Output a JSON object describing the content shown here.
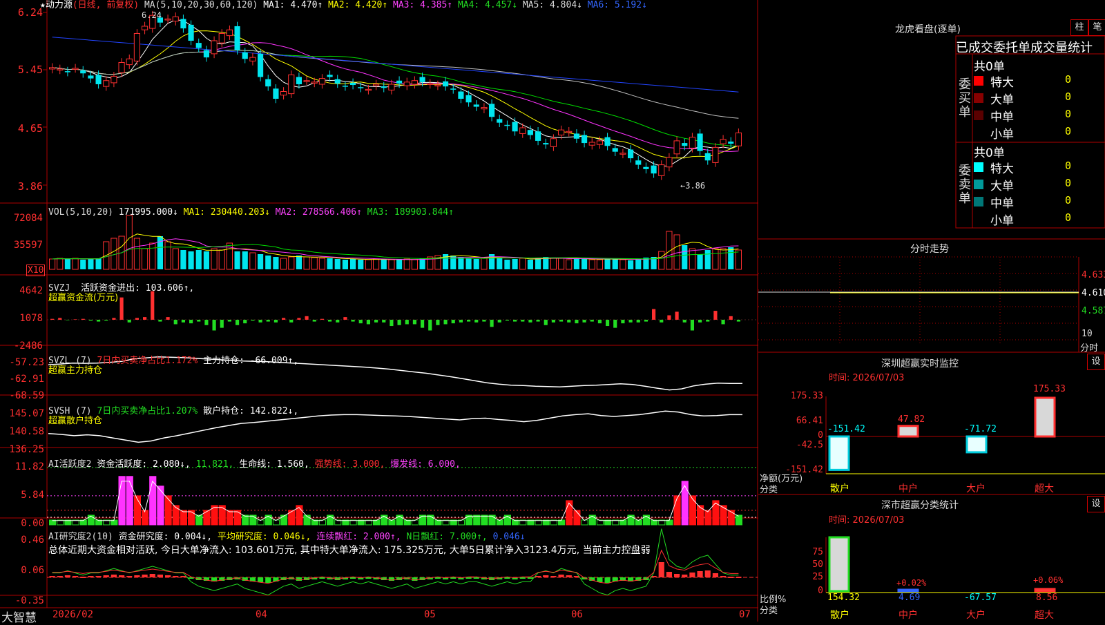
{
  "colors": {
    "up": "#ff3030",
    "down": "#00e5ee",
    "grid": "#b00000",
    "ma1": "#ffffff",
    "ma2": "#ffff00",
    "ma3": "#ff33ff",
    "ma4": "#00dd00",
    "ma5": "#c0c0c0",
    "ma6": "#2244ff",
    "text_yellow": "#ffff00",
    "text_magenta": "#ff44ff",
    "text_green": "#22dd22",
    "text_red": "#ff3030",
    "text_blue": "#3366ff"
  },
  "main": {
    "star": "★",
    "name": "动力源",
    "period": "(日线, 前复权)",
    "ma_params": "MA(5,10,20,30,60,120)",
    "ma_values": [
      {
        "label": "MA1: 4.470↑",
        "color": "ma1"
      },
      {
        "label": "MA2: 4.420↑",
        "color": "ma2"
      },
      {
        "label": "MA3: 4.385↑",
        "color": "ma3"
      },
      {
        "label": "MA4: 4.457↓",
        "color": "ma4"
      },
      {
        "label": "MA5: 4.804↓",
        "color": "ma5"
      },
      {
        "label": "MA6: 5.192↓",
        "color": "ma6"
      }
    ],
    "high_mark": "6.24",
    "low_mark": "←3.86",
    "y_ticks": [
      "6.24",
      "5.45",
      "4.65",
      "3.86"
    ]
  },
  "vol": {
    "title": "VOL(5,10,20)",
    "value": "171995.000↓",
    "ma1": "MA1: 230440.203↓",
    "ma2": "MA2: 278566.406↑",
    "ma3": "MA3: 189903.844↑",
    "y_ticks": [
      "72084",
      "35597"
    ],
    "unit": "X10"
  },
  "svzj": {
    "title": "SVZJ",
    "label": "活跃资金进出: 103.606↑,",
    "sub": "超赢资金流(万元)",
    "y_ticks": [
      "4642",
      "1078",
      "-2486"
    ]
  },
  "svzl": {
    "title": "SVZL (7)",
    "label1": "7日内买卖净占比1.172%",
    "label2": "主力持仓: -66.009↑,",
    "sub": "超赢主力持仓",
    "y_ticks": [
      "-57.23",
      "-62.91",
      "-68.59"
    ]
  },
  "svsh": {
    "title": "SVSH (7)",
    "label1": "7日内买卖净占比1.207%",
    "label2": "散户持仓: 142.822↓,",
    "sub": "超赢散户持仓",
    "y_ticks": [
      "145.07",
      "140.58",
      "136.25"
    ]
  },
  "ai1": {
    "title": "AI活跃度2",
    "l1": "资金活跃度: 2.080↓,",
    "l2": "11.821,",
    "l3": "生命线: 1.560,",
    "l4": "强势线: 3.000,",
    "l5": "爆发线: 6.000,",
    "y_ticks": [
      "11.82",
      "5.84",
      "0.00"
    ]
  },
  "ai2": {
    "title": "AI研究度2(10)",
    "l1": "资金研究度: 0.004↓,",
    "l2": "平均研究度: 0.046↓,",
    "l3": "连续飘红: 2.000↑,",
    "l4": "N日飘红: 7.000↑,",
    "l5": "0.046↓",
    "summary": "总体近期大资金相对活跃, 今日大单净流入: 103.601万元, 其中特大单净流入: 175.325万元, 大单5日累计净入3123.4万元, 当前主力控盘弱",
    "y_ticks": [
      "0.46",
      "0.06",
      "-0.35"
    ]
  },
  "xaxis": {
    "brand": "大智慧",
    "labels": [
      "2026/02",
      "04",
      "05",
      "06",
      "07"
    ]
  },
  "right": {
    "title": "龙虎看盘(逐单)",
    "tab1": "柱",
    "tab2": "笔",
    "section_title": "已成交委托单成交量统计",
    "buy": {
      "side": "委买单",
      "total": "共0单",
      "rows": [
        {
          "label": "特大",
          "val": "0",
          "color": "#ff0000"
        },
        {
          "label": "大单",
          "val": "0",
          "color": "#990000"
        },
        {
          "label": "中单",
          "val": "0",
          "color": "#660000"
        },
        {
          "label": "小单",
          "val": "0",
          "color": "#000000"
        }
      ]
    },
    "sell": {
      "side": "委卖单",
      "total": "共0单",
      "rows": [
        {
          "label": "特大",
          "val": "0",
          "color": "#00ffff"
        },
        {
          "label": "大单",
          "val": "0",
          "color": "#009999"
        },
        {
          "label": "中单",
          "val": "0",
          "color": "#006666"
        },
        {
          "label": "小单",
          "val": "0",
          "color": "#000000"
        }
      ]
    },
    "intraday": {
      "title": "分时走势",
      "y_ticks": [
        "4.633",
        "4.610",
        "4.587"
      ],
      "bottom": "10",
      "unit": "分时"
    },
    "sz_monitor": {
      "title": "深圳超赢实时监控",
      "set": "设",
      "time": "时间: 2026/07/03",
      "y_ticks": [
        "175.33",
        "66.41",
        "0",
        "-42.5",
        "-151.42"
      ],
      "ylabel": "净额(万元)",
      "xlabel": "分类",
      "bars": [
        {
          "cat": "散户",
          "value": -151.42,
          "label": "-151.42"
        },
        {
          "cat": "中户",
          "value": 47.82,
          "label": "47.82"
        },
        {
          "cat": "大户",
          "value": -71.72,
          "label": "-71.72"
        },
        {
          "cat": "超大",
          "value": 175.33,
          "label": "175.33"
        }
      ]
    },
    "sz_stats": {
      "title": "深市超赢分类统计",
      "set": "设",
      "time": "时间: 2026/07/03",
      "y_ticks": [
        "75",
        "50",
        "25",
        "0"
      ],
      "ylabel": "比例%",
      "xlabel": "分类",
      "bars": [
        {
          "cat": "散户",
          "value": 100,
          "label": "154.32"
        },
        {
          "cat": "中户",
          "value": 2,
          "label": "4.69",
          "top": "+0.02%"
        },
        {
          "cat": "大户",
          "value": 0,
          "label": "-67.57"
        },
        {
          "cat": "超大",
          "value": 4,
          "label": "8.56",
          "top": "+0.06%"
        }
      ]
    }
  },
  "chart_data": [
    {
      "type": "candlestick",
      "title": "动力源 (日线, 前复权)",
      "ylim": [
        3.86,
        6.24
      ],
      "close": [
        5.48,
        5.46,
        5.42,
        5.47,
        5.4,
        5.33,
        5.25,
        5.3,
        5.36,
        5.55,
        5.6,
        5.95,
        6.05,
        6.2,
        6.1,
        6.15,
        6.18,
        6.02,
        5.85,
        5.75,
        5.62,
        5.85,
        5.95,
        6.0,
        5.72,
        5.6,
        5.62,
        5.35,
        5.22,
        5.05,
        5.15,
        5.38,
        5.25,
        5.3,
        5.28,
        5.33,
        5.35,
        5.26,
        5.22,
        5.24,
        5.2,
        5.18,
        5.25,
        5.2,
        5.25,
        5.26,
        5.28,
        5.3,
        5.28,
        5.26,
        5.24,
        5.22,
        5.18,
        5.05,
        5.0,
        4.94,
        4.93,
        4.8,
        4.72,
        4.68,
        4.6,
        4.65,
        4.55,
        4.47,
        4.42,
        4.5,
        4.62,
        4.6,
        4.5,
        4.44,
        4.45,
        4.47,
        4.4,
        4.32,
        4.3,
        4.23,
        4.14,
        4.08,
        4.02,
        4.14,
        4.24,
        4.47,
        4.4,
        4.52,
        4.33,
        4.2,
        4.38,
        4.49,
        4.43,
        4.58
      ]
    },
    {
      "type": "bar",
      "title": "VOL(5,10,20)",
      "ylim": [
        0,
        72084
      ],
      "values": [
        15,
        16,
        15,
        16,
        14,
        15,
        16,
        40,
        45,
        48,
        78,
        45,
        30,
        38,
        48,
        40,
        30,
        28,
        26,
        28,
        26,
        30,
        28,
        38,
        26,
        26,
        24,
        22,
        20,
        18,
        16,
        18,
        20,
        18,
        17,
        16,
        16,
        15,
        14,
        15,
        14,
        14,
        15,
        14,
        14,
        14,
        15,
        14,
        16,
        18,
        20,
        22,
        20,
        18,
        16,
        15,
        16,
        22,
        16,
        14,
        15,
        16,
        14,
        16,
        18,
        16,
        16,
        14,
        16,
        15,
        14,
        14,
        16,
        15,
        14,
        13,
        15,
        17,
        18,
        26,
        55,
        50,
        35,
        30,
        22,
        28,
        30,
        30,
        32,
        28
      ]
    },
    {
      "type": "bar",
      "title": "超赢资金流(万元)",
      "ylim": [
        -2486,
        4642
      ],
      "values": [
        100,
        200,
        -50,
        50,
        100,
        -100,
        -200,
        -100,
        200,
        2500,
        -300,
        200,
        300,
        3200,
        -200,
        300,
        -500,
        -300,
        -400,
        -200,
        -600,
        -1200,
        -900,
        -200,
        -600,
        -400,
        -100,
        -300,
        -200,
        -300,
        200,
        -300,
        200,
        400,
        -200,
        100,
        -200,
        -300,
        300,
        -200,
        -400,
        -500,
        -300,
        -300,
        -700,
        -600,
        -500,
        -500,
        -900,
        -1200,
        -600,
        -500,
        -400,
        -300,
        -200,
        -300,
        -200,
        -800,
        -300,
        -100,
        -200,
        -200,
        -300,
        -200,
        -600,
        -300,
        -200,
        -300,
        -400,
        -300,
        -200,
        -400,
        -700,
        -900,
        -400,
        -300,
        -300,
        -200,
        1200,
        -300,
        500,
        900,
        -300,
        -1200,
        -300,
        -200,
        1000,
        -500,
        400,
        -200
      ]
    },
    {
      "type": "line",
      "title": "超赢主力持仓",
      "ylim": [
        -68.59,
        -57.23
      ],
      "values": [
        -60.5,
        -60.3,
        -60.0,
        -60.1,
        -60.0,
        -59.8,
        -59.5,
        -58.8,
        -58.5,
        -58.2,
        -58.3,
        -58.4,
        -58.6,
        -58.8,
        -59.0,
        -59.2,
        -59.4,
        -59.5,
        -59.6,
        -59.8,
        -60.0,
        -60.2,
        -60.4,
        -60.6,
        -60.8,
        -61.0,
        -61.2,
        -61.5,
        -61.8,
        -62.2,
        -62.6,
        -63.0,
        -63.5,
        -64.0,
        -64.6,
        -65.2,
        -65.8,
        -66.2,
        -66.5,
        -66.6,
        -66.8,
        -66.9,
        -67.0,
        -66.8,
        -66.6,
        -66.5,
        -66.3,
        -66.1,
        -66.3,
        -66.8,
        -67.4,
        -67.9,
        -67.6,
        -66.7,
        -66.2,
        -65.9,
        -66.0,
        -66.0
      ]
    },
    {
      "type": "line",
      "title": "超赢散户持仓",
      "ylim": [
        136.25,
        145.07
      ],
      "values": [
        138.5,
        138.3,
        138.0,
        138.2,
        138.0,
        137.5,
        137.0,
        136.5,
        136.8,
        137.5,
        138.0,
        138.6,
        139.2,
        139.8,
        140.3,
        140.8,
        141.0,
        141.3,
        141.6,
        141.9,
        142.2,
        142.5,
        142.7,
        142.8,
        142.8,
        142.7,
        142.6,
        142.5,
        142.4,
        142.2,
        142.0,
        141.8,
        141.6,
        141.9,
        142.0,
        141.7,
        141.5,
        141.2,
        141.5,
        142.0,
        142.5,
        142.8,
        143.0,
        142.6,
        142.4,
        142.6,
        142.8,
        143.2,
        143.6,
        143.4,
        142.8,
        142.5,
        142.6,
        142.8,
        142.8
      ]
    },
    {
      "type": "bar",
      "title": "AI活跃度2",
      "ylim": [
        0,
        11.82
      ],
      "values": [
        1,
        1,
        1,
        1,
        1,
        2,
        1,
        1,
        1,
        10,
        10,
        6,
        3,
        10,
        8,
        6,
        4,
        3,
        3,
        2,
        3,
        4,
        4,
        3,
        3,
        2,
        2,
        1,
        2,
        1,
        2,
        3,
        4,
        2,
        1,
        1,
        2,
        1,
        1,
        1,
        1,
        1,
        1,
        2,
        1,
        2,
        1,
        1,
        2,
        2,
        1,
        1,
        1,
        1,
        2,
        2,
        2,
        2,
        1,
        2,
        1,
        1,
        1,
        1,
        1,
        1,
        1,
        5,
        3,
        1,
        2,
        1,
        1,
        1,
        1,
        2,
        1,
        2,
        1,
        1,
        1,
        6,
        9,
        6,
        4,
        3,
        5,
        4,
        3,
        2
      ]
    },
    {
      "type": "bar",
      "title": "AI研究度2(10)",
      "ylim": [
        -0.35,
        0.46
      ],
      "values": [
        0.02,
        0.02,
        0.03,
        0.02,
        0.01,
        0.02,
        0.02,
        0.03,
        0.04,
        0.03,
        0.02,
        0.03,
        0.04,
        0.05,
        0.04,
        0.03,
        0.02,
        0.02,
        -0.02,
        -0.04,
        -0.05,
        -0.06,
        -0.05,
        -0.04,
        -0.03,
        -0.05,
        -0.06,
        -0.07,
        -0.08,
        -0.06,
        -0.04,
        -0.03,
        -0.05,
        -0.04,
        -0.03,
        -0.02,
        -0.03,
        -0.04,
        -0.03,
        -0.02,
        -0.03,
        -0.02,
        -0.03,
        -0.04,
        -0.05,
        -0.04,
        -0.03,
        -0.05,
        -0.04,
        -0.03,
        -0.02,
        -0.03,
        -0.02,
        -0.03,
        -0.02,
        -0.02,
        -0.03,
        -0.04,
        -0.03,
        -0.02,
        -0.03,
        -0.02,
        -0.02,
        0.02,
        0.03,
        0.02,
        0.04,
        0.03,
        0.02,
        -0.03,
        -0.05,
        -0.07,
        -0.08,
        -0.06,
        -0.05,
        -0.06,
        -0.05,
        -0.04,
        0.02,
        0.22,
        0.08,
        0.05,
        0.04,
        0.07,
        0.09,
        0.1,
        0.06,
        0.02,
        0.01,
        0.01
      ]
    }
  ]
}
